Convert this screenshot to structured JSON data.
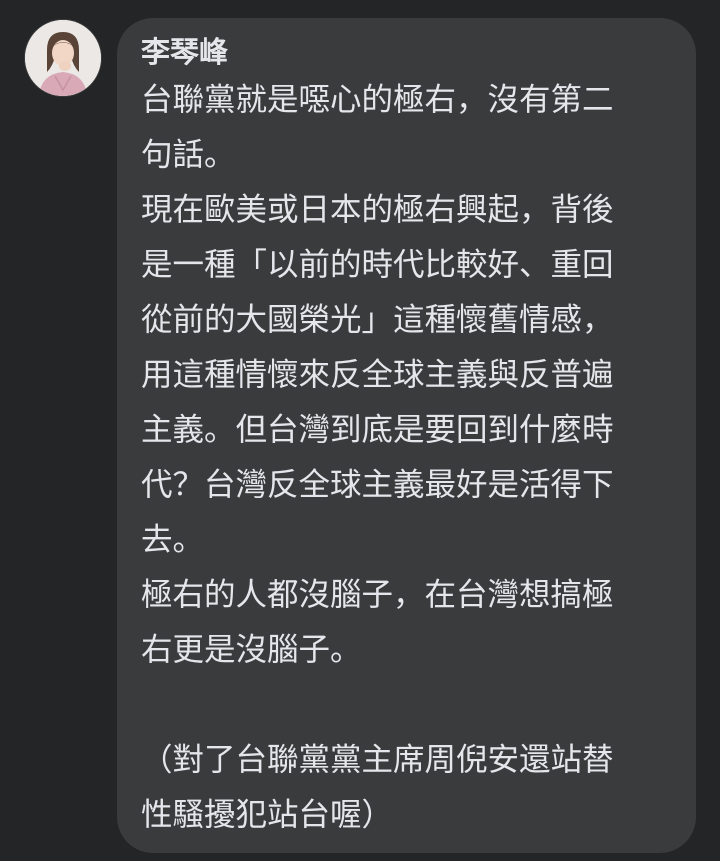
{
  "comment": {
    "author": "李琴峰",
    "lines": [
      "台聯黨就是噁心的極右，沒有第二",
      "句話。",
      "現在歐美或日本的極右興起，背後",
      "是一種「以前的時代比較好、重回",
      "從前的大國榮光」這種懷舊情感，",
      "用這種情懷來反全球主義與反普遍",
      "主義。但台灣到底是要回到什麼時",
      "代？台灣反全球主義最好是活得下",
      "去。",
      "極右的人都沒腦子，在台灣想搞極",
      "右更是沒腦子。",
      "",
      "（對了台聯黨黨主席周倪安還站替",
      "性騷擾犯站台喔）"
    ]
  },
  "colors": {
    "background": "#242526",
    "bubble": "#3a3b3c",
    "text": "#e4e6eb"
  }
}
